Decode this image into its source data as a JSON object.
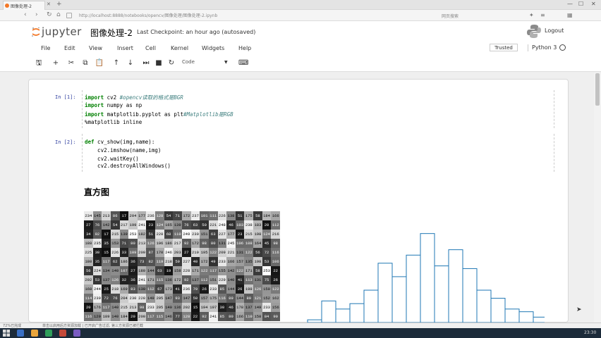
{
  "browser": {
    "tab_title": "图像处理-2",
    "url": "http://localhost:8888/notebooks/opencv/图像处理/图像处理-2.ipynb",
    "search_placeholder": "网页搜索"
  },
  "header": {
    "logo_text": "jupyter",
    "notebook_title": "图像处理-2",
    "checkpoint": "Last Checkpoint: an hour ago (autosaved)",
    "logout_label": "Logout"
  },
  "menu": {
    "items": [
      "File",
      "Edit",
      "View",
      "Insert",
      "Cell",
      "Kernel",
      "Widgets",
      "Help"
    ],
    "trusted_label": "Trusted",
    "kernel_name": "Python 3"
  },
  "toolbar": {
    "cell_type": "Code"
  },
  "cells": [
    {
      "prompt": "In [1]:",
      "lines": [
        {
          "kw": "import",
          "code": " cv2 ",
          "comment": "#opencv读取的格式是BGR"
        },
        {
          "kw": "import",
          "code": " numpy as np",
          "comment": ""
        },
        {
          "kw": "import",
          "code": " matplotlib.pyplot as plt",
          "comment": "#Matplotlib是RGB"
        },
        {
          "kw": "",
          "code": "%matplotlib inline",
          "comment": ""
        }
      ]
    },
    {
      "prompt": "In [2]:",
      "lines": [
        {
          "kw": "def",
          "code": " cv_show(img,name):",
          "comment": ""
        },
        {
          "kw": "",
          "code": "    cv2.imshow(name,img)",
          "comment": ""
        },
        {
          "kw": "",
          "code": "    cv2.waitKey()",
          "comment": ""
        },
        {
          "kw": "",
          "code": "    cv2.destroyAllWindows()",
          "comment": ""
        }
      ]
    }
  ],
  "markdown": {
    "heading": "直方图"
  },
  "grid_values": [
    [
      "234",
      "145",
      "213",
      "86",
      "17",
      "204",
      "177",
      "236",
      "128",
      "54",
      "71",
      "172",
      "237",
      "101",
      "111",
      "226",
      "138",
      "51",
      "175",
      "58",
      "184",
      "166"
    ],
    [
      "27",
      "76",
      "142",
      "54",
      "217",
      "199",
      "241",
      "23",
      "124",
      "165",
      "139",
      "76",
      "63",
      "50",
      "221",
      "248",
      "46",
      "103",
      "238",
      "183",
      "20",
      "112"
    ],
    [
      "34",
      "92",
      "17",
      "215",
      "139",
      "253",
      "182",
      "51",
      "228",
      "68",
      "110",
      "249",
      "230",
      "151",
      "63",
      "227",
      "177",
      "23",
      "215",
      "198",
      "124",
      "216"
    ],
    [
      "188",
      "235",
      "35",
      "153",
      "71",
      "80",
      "213",
      "126",
      "196",
      "186",
      "217",
      "92",
      "172",
      "98",
      "80",
      "131",
      "245",
      "106",
      "108",
      "164",
      "45",
      "98"
    ],
    [
      "225",
      "30",
      "15",
      "226",
      "33",
      "109",
      "209",
      "87",
      "170",
      "246",
      "203",
      "27",
      "219",
      "195",
      "122",
      "209",
      "221",
      "131",
      "122",
      "56",
      "72",
      "116"
    ],
    [
      "180",
      "35",
      "117",
      "62",
      "186",
      "36",
      "73",
      "82",
      "119",
      "218",
      "59",
      "227",
      "40",
      "172",
      "49",
      "233",
      "166",
      "157",
      "135",
      "198",
      "53",
      "106"
    ],
    [
      "56",
      "224",
      "134",
      "140",
      "107",
      "27",
      "180",
      "144",
      "63",
      "19",
      "158",
      "228",
      "171",
      "122",
      "117",
      "155",
      "142",
      "122",
      "171",
      "58",
      "253",
      "22"
    ],
    [
      "202",
      "53",
      "137",
      "126",
      "32",
      "36",
      "241",
      "171",
      "115",
      "136",
      "172",
      "92",
      "137",
      "112",
      "151",
      "229",
      "140",
      "41",
      "113",
      "131",
      "75",
      "26"
    ],
    [
      "168",
      "244",
      "25",
      "218",
      "169",
      "83",
      "130",
      "112",
      "67",
      "173",
      "41",
      "236",
      "79",
      "26",
      "233",
      "85",
      "144",
      "26",
      "198",
      "126",
      "150",
      "122"
    ],
    [
      "114",
      "239",
      "72",
      "76",
      "204",
      "230",
      "228",
      "149",
      "205",
      "147",
      "93",
      "147",
      "50",
      "157",
      "175",
      "116",
      "89",
      "144",
      "89",
      "121",
      "152",
      "162"
    ],
    [
      "20",
      "176",
      "117",
      "140",
      "215",
      "213",
      "98",
      "233",
      "205",
      "140",
      "136",
      "202",
      "15",
      "194",
      "197",
      "30",
      "46",
      "178",
      "137",
      "149",
      "233",
      "156"
    ],
    [
      "116",
      "129",
      "189",
      "140",
      "184",
      "20",
      "200",
      "117",
      "115",
      "146",
      "77",
      "128",
      "22",
      "92",
      "241",
      "85",
      "80",
      "166",
      "110",
      "158",
      "84",
      "90"
    ]
  ],
  "histogram": {
    "type": "bar",
    "values": [
      1,
      8,
      5,
      7,
      12,
      22,
      17,
      25,
      33,
      21,
      27,
      20,
      12,
      9,
      5,
      4,
      2
    ]
  },
  "status": {
    "left_text": "72%已完成",
    "hint_text": "单击以启用后方资源加载 | 已开启广告过滤, 第三方资源已被拦截",
    "clock": "23:30"
  }
}
